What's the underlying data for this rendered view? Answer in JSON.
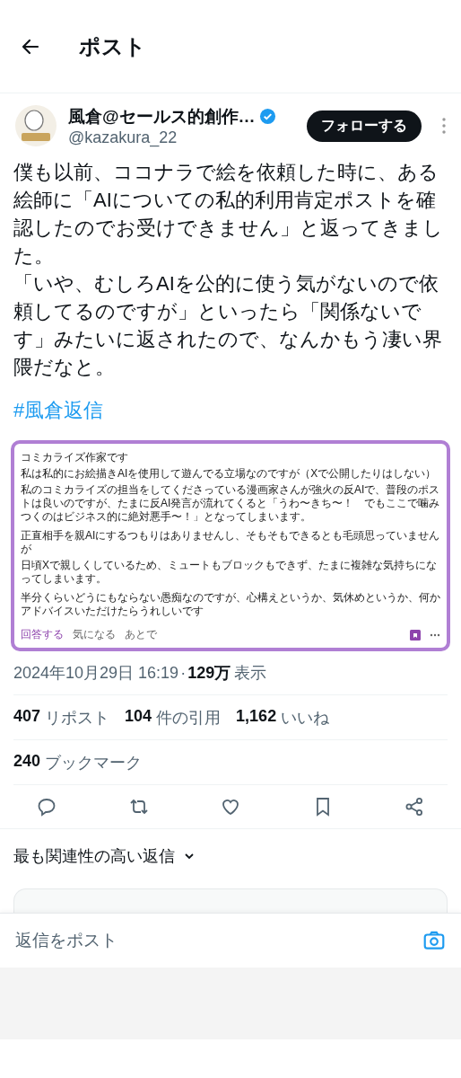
{
  "header": {
    "title": "ポスト"
  },
  "author": {
    "name": "風倉@セールス的創作…",
    "handle": "@kazakura_22",
    "verified": true,
    "follow_label": "フォローする"
  },
  "post": {
    "paragraphs": [
      "僕も以前、ココナラで絵を依頼した時に、ある絵師に「AIについての私的利用肯定ポストを確認したのでお受けできません」と返ってきました。",
      "「いや、むしろAIを公的に使う気がないので依頼してるのですが」といったら「関係ないです」みたいに返されたので、なんかもう凄い界隈だなと。"
    ],
    "hashtag": "#風倉返信"
  },
  "embedded_image": {
    "paragraphs": [
      [
        "コミカライズ作家です",
        "私は私的にお絵描きAIを使用して遊んでる立場なのですが（Xで公開したりはしない）",
        "私のコミカライズの担当をしてくださっている漫画家さんが強火の反AIで、普段のポストは良いのですが、たまに反AI発言が流れてくると「うわ〜きち〜！　でもここで噛みつくのはビジネス的に絶対悪手〜！」となってしまいます。"
      ],
      [
        "正直相手を親AIにするつもりはありませんし、そもそもできるとも毛頭思っていませんが",
        "日頃Xで親しくしているため、ミュートもブロックもできず、たまに複雑な気持ちになってしまいます。"
      ],
      [
        "半分くらいどうにもならない愚痴なのですが、心構えというか、気休めというか、何かアドバイスいただけたらうれしいです"
      ]
    ],
    "actions": [
      {
        "label": "回答する",
        "kind": "primary"
      },
      {
        "label": "気になる",
        "kind": "plain"
      },
      {
        "label": "あとで",
        "kind": "plain"
      }
    ]
  },
  "timestamp": "2024年10月29日 16:19",
  "separator": "·",
  "views": {
    "count": "129万",
    "label": "表示"
  },
  "stats": [
    {
      "count": "407",
      "label": "リポスト"
    },
    {
      "count": "104",
      "label": "件の引用"
    },
    {
      "count": "1,162",
      "label": "いいね"
    }
  ],
  "bookmarks": {
    "count": "240",
    "label": "ブックマーク"
  },
  "sort": {
    "label": "最も関連性の高い返信"
  },
  "reply": {
    "placeholder": "返信をポスト"
  }
}
